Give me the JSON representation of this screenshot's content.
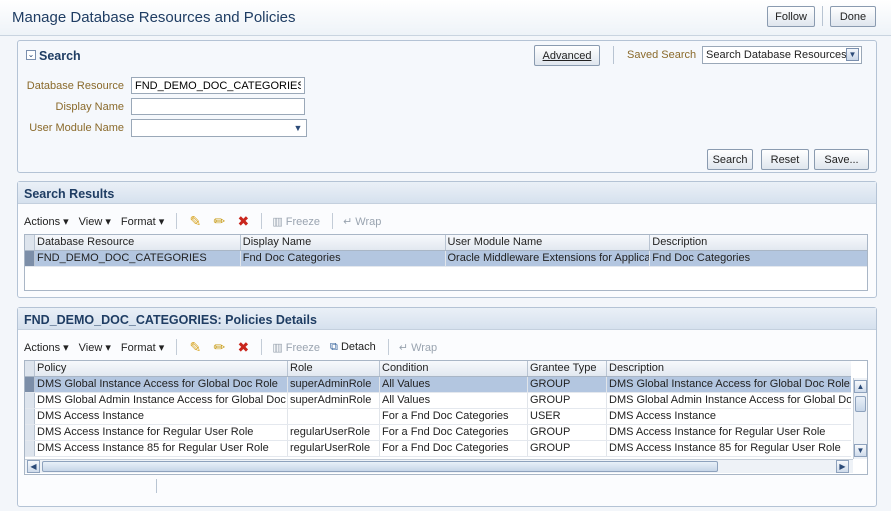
{
  "page": {
    "title": "Manage Database Resources and Policies",
    "follow_label": "Follow",
    "done_label": "Done"
  },
  "search": {
    "header": "Search",
    "advanced_label": "Advanced",
    "saved_search_label": "Saved Search",
    "saved_search_value": "Search Database Resources",
    "fields": {
      "database_resource_label": "Database Resource",
      "database_resource_value": "FND_DEMO_DOC_CATEGORIES",
      "display_name_label": "Display Name",
      "display_name_value": "",
      "user_module_name_label": "User Module Name",
      "user_module_name_value": ""
    },
    "search_button": "Search",
    "reset_button": "Reset",
    "save_button": "Save..."
  },
  "results": {
    "header": "Search Results",
    "toolbar": {
      "actions": "Actions",
      "view": "View",
      "format": "Format",
      "freeze": "Freeze",
      "wrap": "Wrap"
    },
    "columns": [
      "Database Resource",
      "Display Name",
      "User Module Name",
      "Description"
    ],
    "rows": [
      [
        "FND_DEMO_DOC_CATEGORIES",
        "Fnd Doc Categories",
        "Oracle Middleware Extensions for Applications",
        "Fnd Doc Categories"
      ]
    ]
  },
  "policies": {
    "header": "FND_DEMO_DOC_CATEGORIES: Policies Details",
    "toolbar": {
      "actions": "Actions",
      "view": "View",
      "format": "Format",
      "freeze": "Freeze",
      "detach": "Detach",
      "wrap": "Wrap"
    },
    "columns": [
      "Policy",
      "Role",
      "Condition",
      "Grantee Type",
      "Description"
    ],
    "rows": [
      [
        "DMS Global Instance Access for Global Doc Role",
        "superAdminRole",
        "All Values",
        "GROUP",
        "DMS Global Instance Access for Global Doc Role"
      ],
      [
        "DMS Global Admin Instance Access for Global Doc Role",
        "superAdminRole",
        "All Values",
        "GROUP",
        "DMS Global Admin Instance Access for Global Doc Role"
      ],
      [
        "DMS Access Instance",
        "",
        "For a Fnd Doc Categories",
        "USER",
        "DMS Access Instance"
      ],
      [
        "DMS Access Instance for Regular User Role",
        "regularUserRole",
        "For a Fnd Doc Categories",
        "GROUP",
        "DMS Access Instance for Regular User Role"
      ],
      [
        "DMS Access Instance 85 for Regular User Role",
        "regularUserRole",
        "For a Fnd Doc Categories",
        "GROUP",
        "DMS Access Instance 85 for Regular User Role"
      ]
    ]
  }
}
